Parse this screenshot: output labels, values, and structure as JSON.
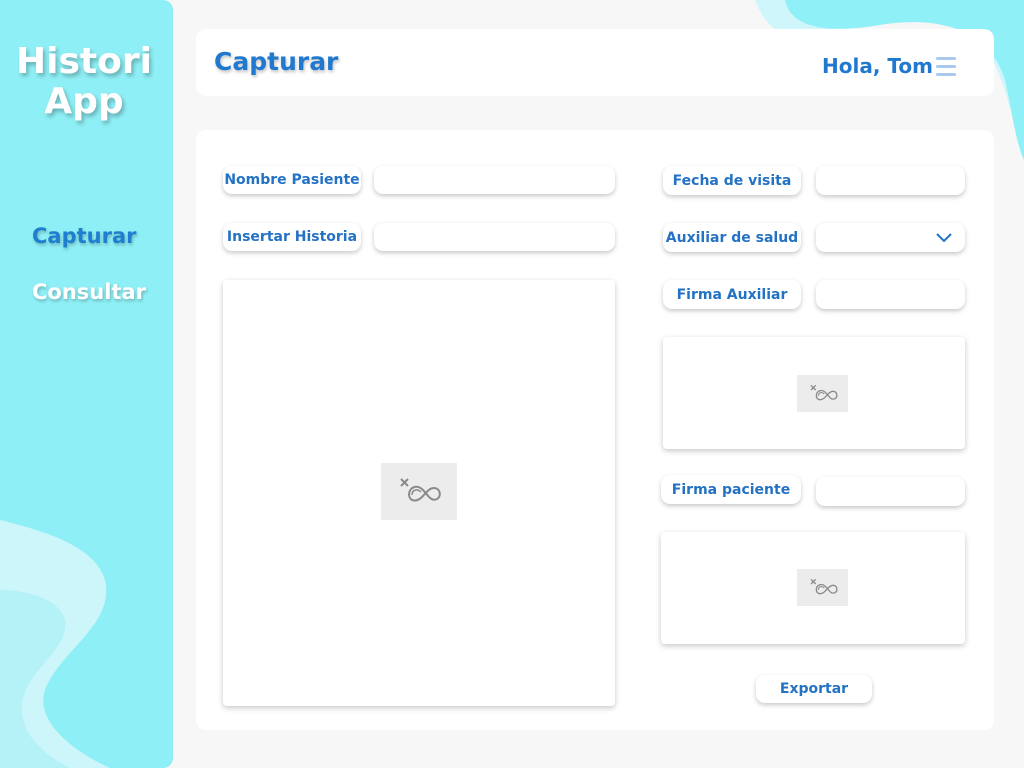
{
  "app": {
    "logo_line1": "Histori",
    "logo_line2": "App"
  },
  "sidebar": {
    "items": [
      {
        "label": "Capturar",
        "active": true
      },
      {
        "label": "Consultar",
        "active": false
      }
    ]
  },
  "header": {
    "title": "Capturar",
    "greeting": "Hola, Tom"
  },
  "form": {
    "patient_name_label": "Nombre Pasiente",
    "patient_name_value": "",
    "insert_history_label": "Insertar Historia",
    "insert_history_value": "",
    "visit_date_label": "Fecha de visita",
    "visit_date_value": "",
    "health_aide_label": "Auxiliar de salud",
    "health_aide_value": "",
    "aide_signature_label": "Firma Auxiliar",
    "aide_signature_value": "",
    "patient_signature_label": "Firma paciente",
    "patient_signature_value": "",
    "export_label": "Exportar"
  },
  "colors": {
    "accent": "#2179cf",
    "sidebar_bg": "#8ef0f6",
    "page_bg": "#f7f7f7"
  },
  "icons": {
    "menu": "hamburger-icon",
    "dropdown": "chevron-down-icon",
    "placeholder": "missing-image-icon"
  }
}
